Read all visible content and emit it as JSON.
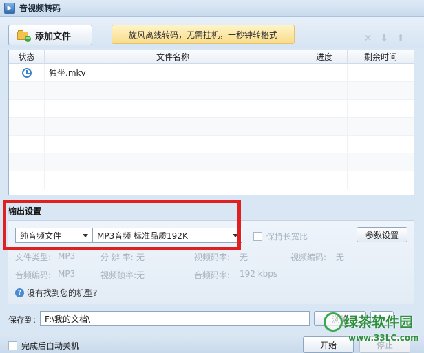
{
  "window": {
    "title": "音视频转码"
  },
  "toolbar": {
    "add_file_label": "添加文件",
    "promo_text": "旋风离线转码，无需挂机，一秒钟转格式",
    "icons": [
      "close-icon",
      "arrow-down-icon",
      "arrow-up-icon"
    ]
  },
  "file_list": {
    "columns": [
      "状态",
      "文件名称",
      "进度",
      "剩余时间"
    ],
    "rows": [
      {
        "status_icon": "clock-icon",
        "name": "独坐.mkv",
        "progress": "",
        "remaining": ""
      }
    ]
  },
  "output_settings": {
    "label": "输出设置",
    "type_select": "纯音频文件",
    "quality_select": "MP3音频 标准品质192K",
    "keep_ratio_label": "保持长宽比",
    "keep_ratio_checked": false,
    "param_button": "参数设置",
    "info": {
      "file_type_label": "文件类型:",
      "file_type_value": "MP3",
      "resolution_label": "分 辨 率:",
      "resolution_value": "无",
      "video_bitrate_label": "视频码率:",
      "video_bitrate_value": "无",
      "video_codec_label": "视频编码:",
      "video_codec_value": "无",
      "audio_codec_label": "音频编码:",
      "audio_codec_value": "MP3",
      "video_framerate_label": "视频帧率:",
      "video_framerate_value": "无",
      "audio_bitrate_label": "音频码率:",
      "audio_bitrate_value": "192 kbps"
    },
    "help_link": "没有找到您的机型?"
  },
  "save": {
    "label": "保存到:",
    "path": "F:\\我的文档\\",
    "browse_button": "浏览"
  },
  "footer": {
    "auto_shutdown_label": "完成后自动关机",
    "start_button": "开始",
    "stop_button": "停止"
  },
  "watermark": {
    "text": "绿茶软件园",
    "url": "www.33LC.com"
  },
  "colors": {
    "highlight_box": "#e02020",
    "accent": "#3e83c8"
  }
}
